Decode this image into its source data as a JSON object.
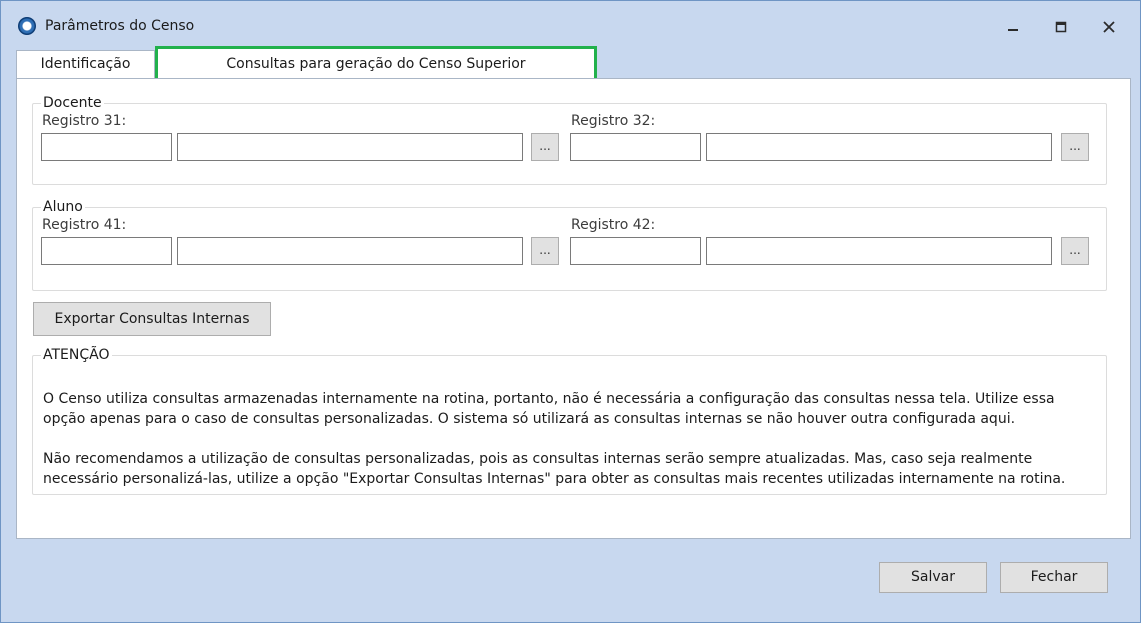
{
  "window": {
    "title": "Parâmetros do Censo",
    "icon": "app-logo-icon",
    "controls": {
      "minimize_icon": "minimize-icon",
      "maximize_icon": "maximize-icon",
      "close_icon": "close-icon"
    }
  },
  "tabs": [
    {
      "label": "Identificação",
      "active": false
    },
    {
      "label": "Consultas para geração do Censo Superior",
      "active": true,
      "highlight_color": "#22b14c"
    }
  ],
  "docente": {
    "legend": "Docente",
    "registro_left": {
      "label": "Registro 31:",
      "code_value": "",
      "query_value": "",
      "browse_label": "..."
    },
    "registro_right": {
      "label": "Registro 32:",
      "code_value": "",
      "query_value": "",
      "browse_label": "..."
    }
  },
  "aluno": {
    "legend": "Aluno",
    "registro_left": {
      "label": "Registro 41:",
      "code_value": "",
      "query_value": "",
      "browse_label": "..."
    },
    "registro_right": {
      "label": "Registro 42:",
      "code_value": "",
      "query_value": "",
      "browse_label": "..."
    }
  },
  "export_button_label": "Exportar Consultas Internas",
  "atencao": {
    "legend": "ATENÇÃO",
    "paragraph1": "O Censo utiliza consultas armazenadas internamente na rotina, portanto, não é necessária a configuração das consultas nessa tela. Utilize essa opção apenas para o caso de consultas personalizadas. O sistema só utilizará as consultas internas se não houver outra configurada aqui.",
    "paragraph2": "Não recomendamos a utilização de consultas personalizadas, pois as consultas internas serão sempre atualizadas. Mas, caso seja realmente necessário personalizá-las, utilize a opção \"Exportar Consultas Internas\" para obter as consultas mais recentes utilizadas internamente na rotina."
  },
  "footer": {
    "save_label": "Salvar",
    "close_label": "Fechar"
  }
}
